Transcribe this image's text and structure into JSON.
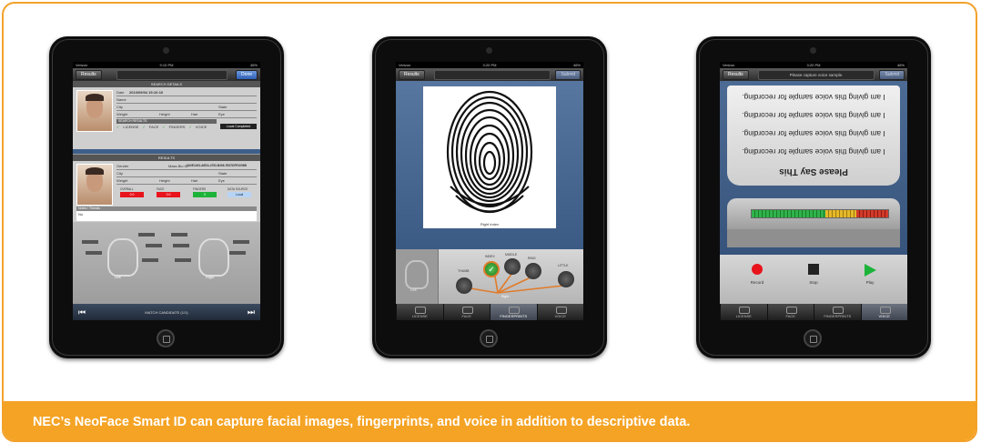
{
  "caption": "NEC’s NeoFace Smart ID can capture facial images, fingerprints, and voice in addition to descriptive data.",
  "status_bar": {
    "carrier": "Verizon",
    "time1": "9:10 PM",
    "time2": "3:20 PM",
    "time3": "3:20 PM",
    "battery": "46%"
  },
  "screen1": {
    "back": "Results",
    "done": "Done",
    "search_head": "SEARCH DETAILS",
    "date_label": "Date",
    "date_value": "2013/09/04 15:10:10",
    "name_label": "Name",
    "city_label": "City",
    "state_label": "State",
    "weight_label": "Weight",
    "height_label": "Height",
    "hair_label": "Hair",
    "eye_label": "Eye",
    "search_results": "SEARCH RESULTS",
    "checks": [
      "LICENSE",
      "FACE",
      "FINGERS",
      "VOICE"
    ],
    "local_completed": "Local Completed",
    "results_head": "RESULTS",
    "gender_label": "Gender",
    "match_id": "Mass Bio ID",
    "match_id_value": "3A0E1403-A6EA-4753-B456-7B37DFE1056B",
    "scores": [
      {
        "label": "OVERALL",
        "value": "0.0",
        "color": "#e8131b"
      },
      {
        "label": "FACE",
        "value": "0.0",
        "color": "#e8131b"
      },
      {
        "label": "FINGERS",
        "value": "0",
        "color": "#1db33a"
      },
      {
        "label": "DATA SOURCE",
        "value": "Local",
        "color": "#b8d4f5"
      }
    ],
    "notes_head": "Notes / Threats",
    "notes_value": "No",
    "left_label": "Left",
    "right_label": "Right",
    "footer": "MATCH CANDIDATE (1/1)"
  },
  "screen2": {
    "back": "Results",
    "submit": "Submit",
    "print_caption": "Right Index",
    "left_label": "Left",
    "right_label": "Right",
    "fingers": [
      "THUMB",
      "INDEX",
      "MIDDLE",
      "RING",
      "LITTLE"
    ],
    "tabs": [
      "LICENSE",
      "FACE",
      "FINGERPRINTS",
      "VOICE"
    ],
    "selected_tab": "FINGERPRINTS"
  },
  "screen3": {
    "back": "Results",
    "title": "Please capture voice sample.",
    "submit": "Submit",
    "prompt_heading": "Please Say This",
    "prompt_line": "I am giving this voice sample for recording.",
    "prompt_lines_count": 4,
    "controls": [
      "Record",
      "Stop",
      "Play"
    ],
    "tabs": [
      "LICENSE",
      "FACE",
      "FINGERPRINTS",
      "VOICE"
    ],
    "selected_tab": "VOICE"
  },
  "colors": {
    "accent": "#f5a324",
    "record": "#e8131b",
    "play": "#1db33a",
    "fill_ok": "#2fb34a",
    "fill_warn": "#e6b92a",
    "fill_bad": "#d23a2a"
  },
  "icons": [
    "record-icon",
    "stop-icon",
    "play-icon",
    "fingerprint-icon",
    "hand-icon",
    "check-icon",
    "skip-first-icon",
    "skip-last-icon"
  ]
}
